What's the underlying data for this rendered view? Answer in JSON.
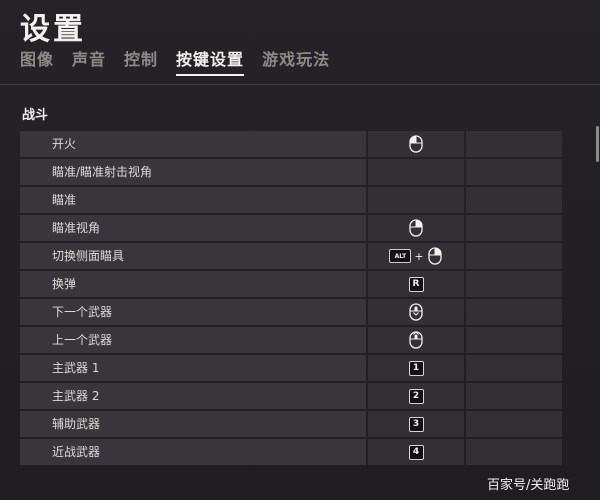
{
  "header": {
    "title": "设置",
    "tabs": [
      {
        "label": "图像"
      },
      {
        "label": "声音"
      },
      {
        "label": "控制"
      },
      {
        "label": "按键设置",
        "active": true
      },
      {
        "label": "游戏玩法"
      }
    ]
  },
  "section": {
    "title": "战斗"
  },
  "bindings": [
    {
      "label": "开火",
      "primary": {
        "type": "mouse",
        "icon": "mouse-left-click-icon"
      },
      "secondary": null
    },
    {
      "label": "瞄准/瞄准射击视角",
      "primary": null,
      "secondary": null
    },
    {
      "label": "瞄准",
      "primary": null,
      "secondary": null
    },
    {
      "label": "瞄准视角",
      "primary": {
        "type": "mouse",
        "icon": "mouse-right-click-icon"
      },
      "secondary": null
    },
    {
      "label": "切换侧面瞄具",
      "primary": {
        "type": "combo",
        "key": "ALT",
        "plus": "+",
        "icon": "mouse-right-click-icon"
      },
      "secondary": null
    },
    {
      "label": "换弹",
      "primary": {
        "type": "key",
        "key": "R"
      },
      "secondary": null
    },
    {
      "label": "下一个武器",
      "primary": {
        "type": "mouse",
        "icon": "mouse-scroll-down-icon"
      },
      "secondary": null
    },
    {
      "label": "上一个武器",
      "primary": {
        "type": "mouse",
        "icon": "mouse-scroll-up-icon"
      },
      "secondary": null
    },
    {
      "label": "主武器 1",
      "primary": {
        "type": "key",
        "key": "1"
      },
      "secondary": null
    },
    {
      "label": "主武器 2",
      "primary": {
        "type": "key",
        "key": "2"
      },
      "secondary": null
    },
    {
      "label": "辅助武器",
      "primary": {
        "type": "key",
        "key": "3"
      },
      "secondary": null
    },
    {
      "label": "近战武器",
      "primary": {
        "type": "key",
        "key": "4"
      },
      "secondary": null
    }
  ],
  "watermark": "百家号/关跑跑",
  "colors": {
    "background": "#222024",
    "row": "#38363a",
    "cell": "#323034",
    "text": "#dcdad6"
  }
}
